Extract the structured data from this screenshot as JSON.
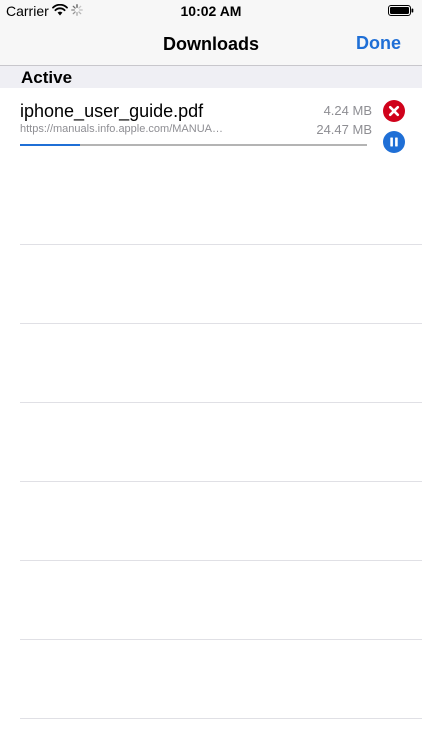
{
  "status_bar": {
    "carrier": "Carrier",
    "time": "10:02 AM",
    "icons": [
      "wifi-icon",
      "activity-spinner-icon",
      "battery-icon"
    ]
  },
  "nav_bar": {
    "title": "Downloads",
    "done_label": "Done"
  },
  "section": {
    "title": "Active"
  },
  "downloads": [
    {
      "file_name": "iphone_user_guide.pdf",
      "url": "https://manuals.info.apple.com/MANUA…",
      "downloaded": "4.24 MB",
      "total": "24.47 MB",
      "progress_fraction": 0.173
    }
  ],
  "colors": {
    "accent": "#1f6fd6",
    "cancel": "#d0021b",
    "secondary_text": "#8e8e93",
    "separator": "#e0e0e5",
    "bar_background": "#f7f7f7"
  }
}
